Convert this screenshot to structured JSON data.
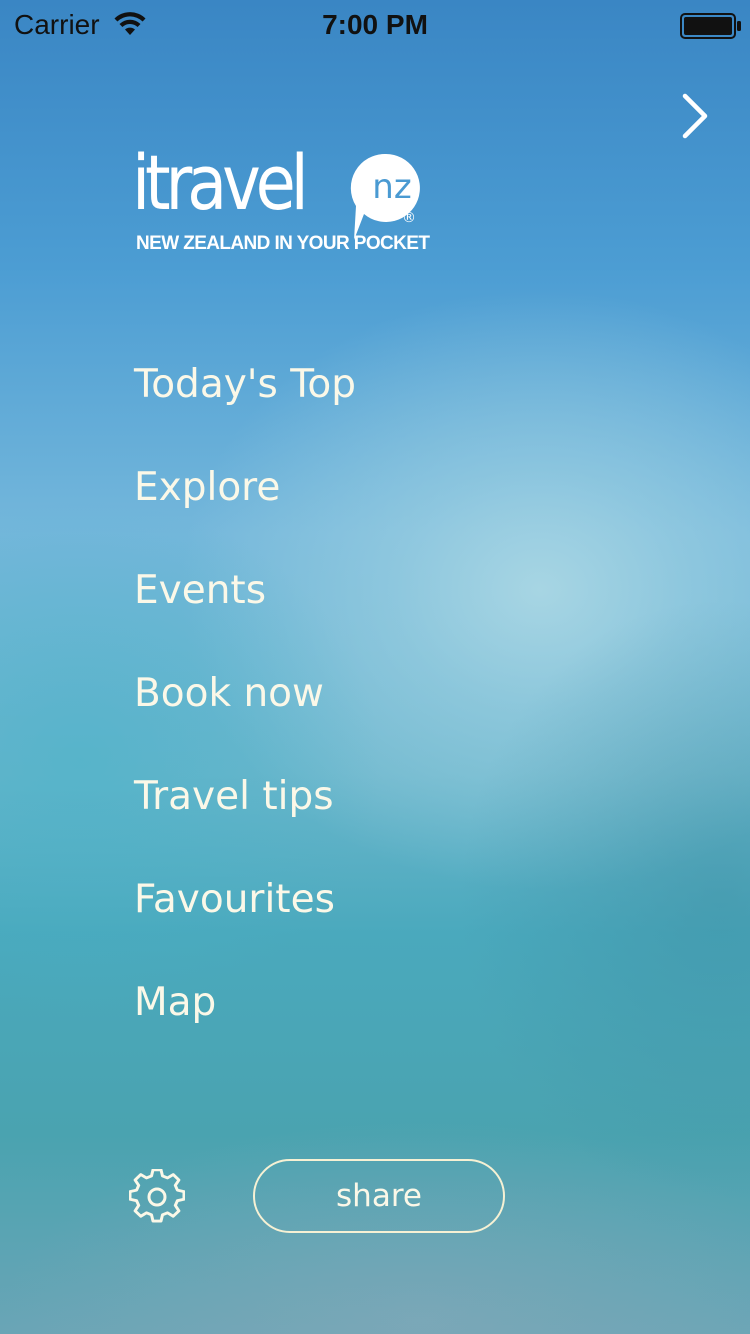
{
  "status_bar": {
    "carrier": "Carrier",
    "time": "7:00 PM",
    "wifi_icon": "wifi-icon",
    "battery_icon": "battery-full-icon"
  },
  "header": {
    "forward_icon": "chevron-right-icon"
  },
  "logo": {
    "wordmark": "itravel",
    "badge": "nz",
    "registered": "®",
    "tagline": "NEW ZEALAND IN YOUR POCKET"
  },
  "menu": {
    "items": [
      {
        "label": "Today's Top"
      },
      {
        "label": "Explore"
      },
      {
        "label": "Events"
      },
      {
        "label": "Book now"
      },
      {
        "label": "Travel tips"
      },
      {
        "label": "Favourites"
      },
      {
        "label": "Map"
      }
    ]
  },
  "footer": {
    "settings_icon": "gear-icon",
    "share_label": "share"
  },
  "colors": {
    "text": "#fbf8e8",
    "background_top": "#3a86c4",
    "background_mid": "#74b7db",
    "background_bottom": "#4aa3b0"
  }
}
